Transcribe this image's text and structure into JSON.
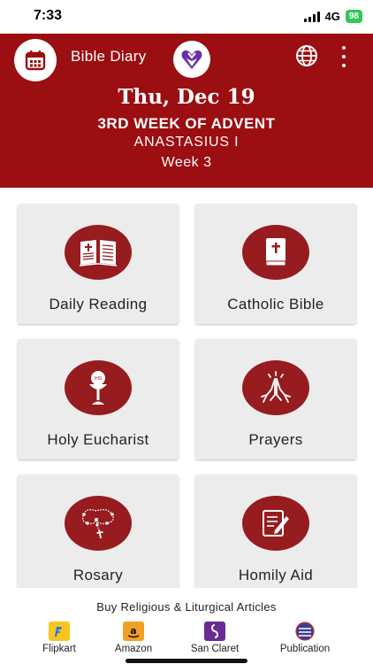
{
  "status_bar": {
    "time": "7:33",
    "network": "4G",
    "battery": "98"
  },
  "header": {
    "app_title": "Bible Diary",
    "date": "Thu, Dec 19",
    "season": "3RD WEEK OF ADVENT",
    "saint": "ANASTASIUS I",
    "week": "Week 3",
    "background_color": "#9b0e11",
    "icons": {
      "calendar": "calendar-icon",
      "logo": "heart-logo-icon",
      "language": "globe-icon",
      "menu": "more-vertical-icon"
    }
  },
  "grid": {
    "icon_color": "#961c1f",
    "items": [
      {
        "label": "Daily Reading",
        "icon": "open-book-icon"
      },
      {
        "label": "Catholic Bible",
        "icon": "bible-icon"
      },
      {
        "label": "Holy Eucharist",
        "icon": "chalice-host-icon"
      },
      {
        "label": "Prayers",
        "icon": "praying-hands-icon"
      },
      {
        "label": "Rosary",
        "icon": "rosary-icon"
      },
      {
        "label": "Homily Aid",
        "icon": "notepad-pen-icon"
      }
    ]
  },
  "shop": {
    "title": "Buy Religious & Liturgical Articles",
    "items": [
      {
        "label": "Flipkart",
        "icon": "flipkart-icon",
        "color": "#f7c51e"
      },
      {
        "label": "Amazon",
        "icon": "amazon-icon",
        "color": "#f0a028"
      },
      {
        "label": "San Claret",
        "icon": "san-claret-icon",
        "color": "#6a2c91"
      },
      {
        "label": "Publication",
        "icon": "publication-icon",
        "color": "#3b3b8f"
      }
    ]
  }
}
